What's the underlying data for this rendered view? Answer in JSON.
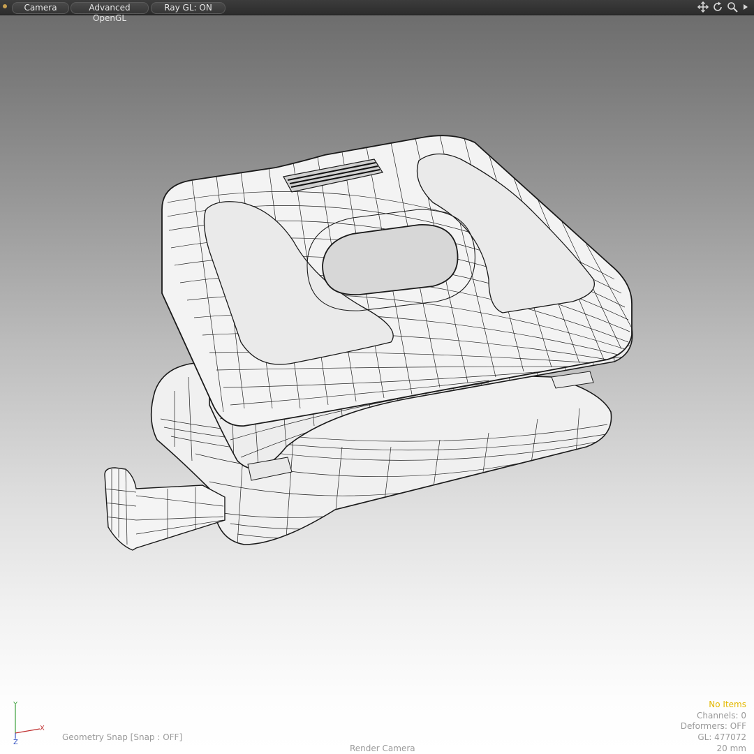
{
  "toolbar": {
    "camera_label": "Camera",
    "shading_label": "Advanced OpenGL",
    "raygl_label": "Ray GL: ON",
    "icons": [
      "move-view-icon",
      "rotate-view-icon",
      "zoom-view-icon",
      "expand-arrow-icon"
    ]
  },
  "hud": {
    "items": "No Items",
    "channels": "Channels: 0",
    "deformers": "Deformers: OFF",
    "gl": "GL: 477072",
    "scale": "20 mm",
    "snap": "Geometry Snap  [Snap : OFF]",
    "camera": "Render Camera"
  },
  "axis": {
    "y": "Y",
    "x": "X",
    "z": "Z"
  },
  "colors": {
    "toolbar_bg": "#2f2f2f",
    "items_text": "#e3b800",
    "hud_text": "#9a9a9a",
    "wire": "#1a1a1a",
    "surface": "#f2f2f2",
    "axis_y": "#3aa03a",
    "axis_x": "#c03030",
    "axis_z": "#3050c0"
  }
}
